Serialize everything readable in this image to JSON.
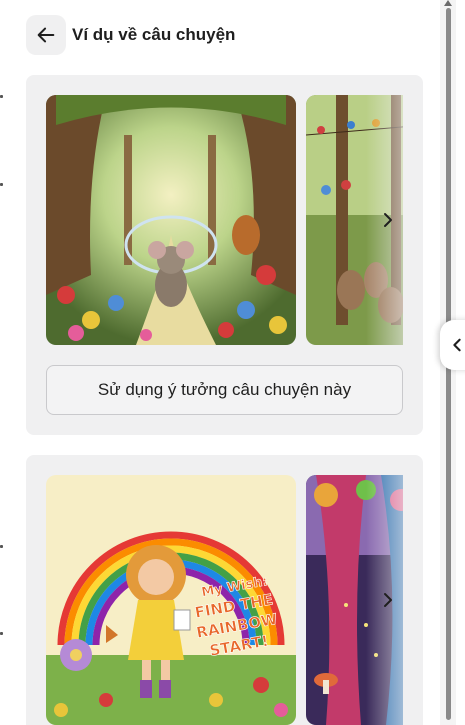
{
  "header": {
    "title": "Ví dụ về câu chuyện",
    "back_icon": "arrow-left-icon"
  },
  "cards": [
    {
      "images": [
        {
          "description_icon": "mouse-forest-illustration"
        },
        {
          "description_icon": "rabbits-forest-illustration"
        }
      ],
      "next_icon": "chevron-right-icon",
      "button_label": "Sử dụng ý tưởng câu chuyện này"
    },
    {
      "images": [
        {
          "description_icon": "rainbow-girl-illustration",
          "cover_text": "My Wish: FIND THE RAINBOW START!"
        },
        {
          "description_icon": "fantasy-trees-illustration"
        }
      ],
      "next_icon": "chevron-right-icon"
    }
  ],
  "side_panel": {
    "collapse_icon": "chevron-left-icon"
  },
  "colors": {
    "card_bg": "#f0f0f1",
    "text": "#1f1f1f"
  }
}
